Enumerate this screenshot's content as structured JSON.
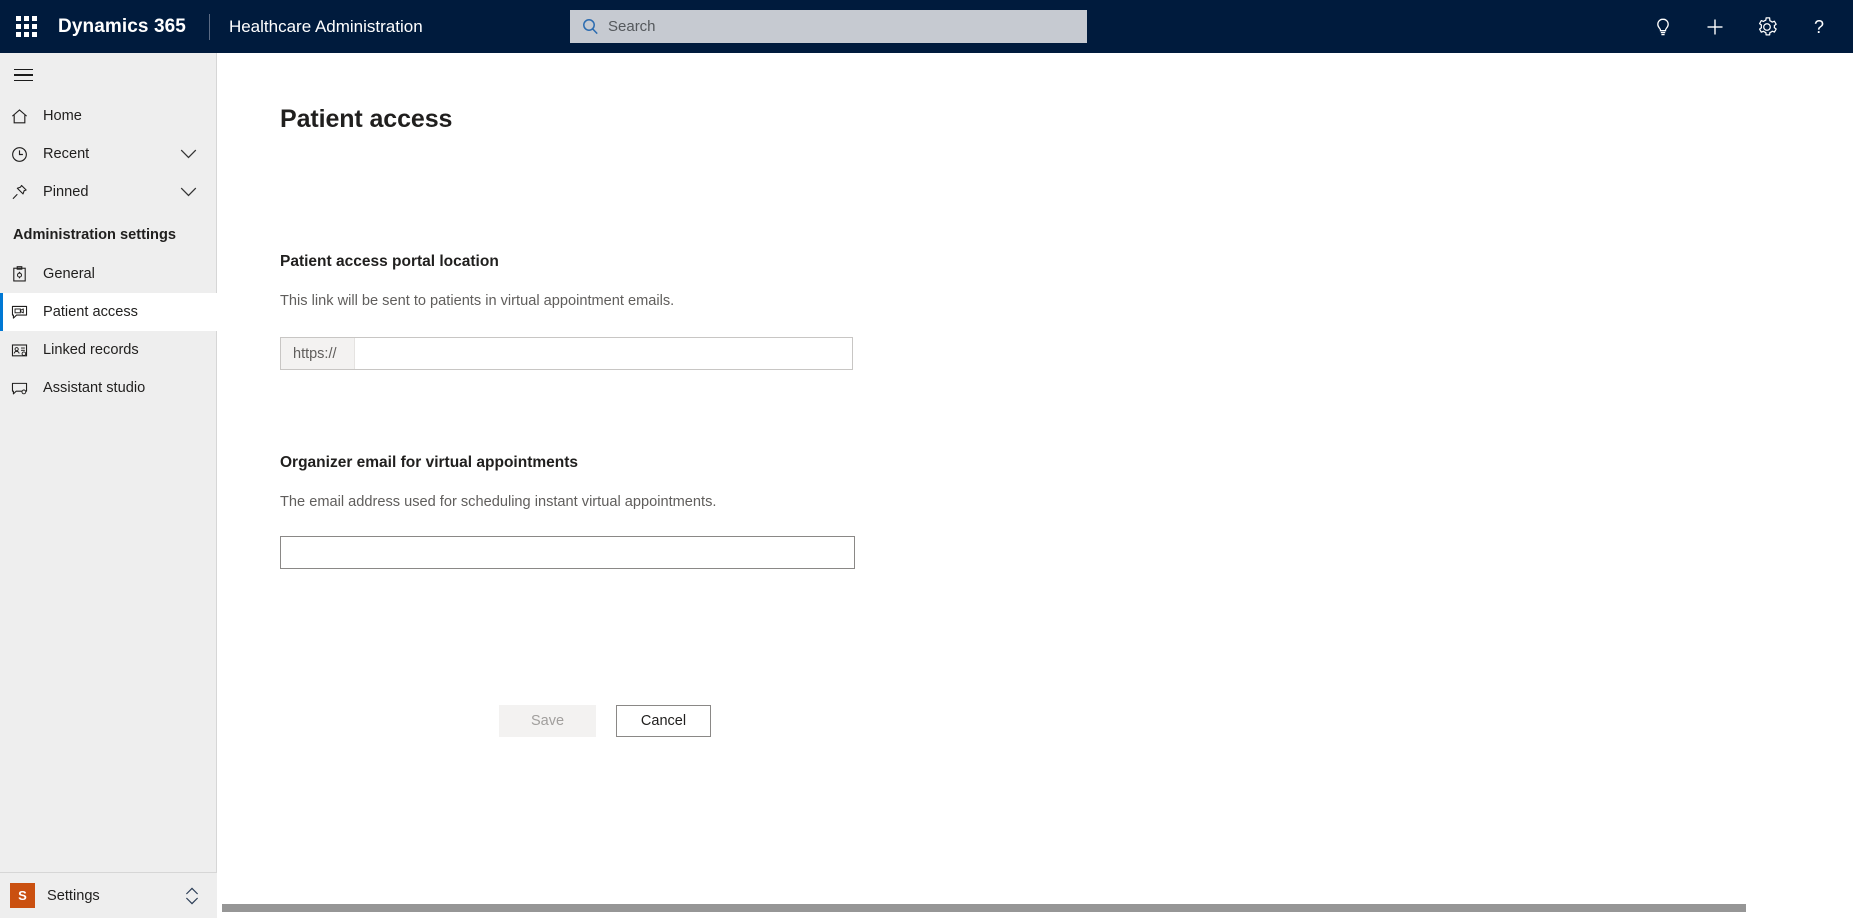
{
  "header": {
    "app_launcher_icon": "waffle-grid-icon",
    "brand": "Dynamics 365",
    "app_name": "Healthcare Administration",
    "search": {
      "placeholder": "Search",
      "value": "",
      "icon": "search-icon"
    },
    "actions": [
      {
        "name": "lightbulb-icon",
        "label": "Lightbulb"
      },
      {
        "name": "plus-icon",
        "label": "New"
      },
      {
        "name": "gear-icon",
        "label": "Settings"
      },
      {
        "name": "question-icon",
        "label": "Help"
      }
    ]
  },
  "sidebar": {
    "collapse_icon": "hamburger-icon",
    "items": [
      {
        "label": "Home",
        "icon": "home-icon",
        "chevron": false,
        "selected": false
      },
      {
        "label": "Recent",
        "icon": "clock-icon",
        "chevron": true,
        "selected": false
      },
      {
        "label": "Pinned",
        "icon": "pin-icon",
        "chevron": true,
        "selected": false
      }
    ],
    "section_title": "Administration settings",
    "section_items": [
      {
        "label": "General",
        "icon": "clipboard-gear-icon",
        "selected": false
      },
      {
        "label": "Patient access",
        "icon": "video-message-icon",
        "selected": true
      },
      {
        "label": "Linked records",
        "icon": "contact-card-gear-icon",
        "selected": false
      },
      {
        "label": "Assistant studio",
        "icon": "chat-gear-icon",
        "selected": false
      }
    ],
    "footer": {
      "badge": "S",
      "label": "Settings",
      "chevron_icon": "chevron-updown-icon"
    }
  },
  "main": {
    "page_title": "Patient access",
    "sections": [
      {
        "heading": "Patient access portal location",
        "description": "This link will be sent to patients in virtual appointment emails.",
        "field": {
          "prefix": "https://",
          "value": "",
          "placeholder": ""
        }
      },
      {
        "heading": "Organizer email for virtual appointments",
        "description": "The email address used for scheduling instant virtual appointments.",
        "field": {
          "value": "",
          "placeholder": ""
        }
      }
    ],
    "actions": {
      "save_label": "Save",
      "save_disabled": true,
      "cancel_label": "Cancel"
    }
  },
  "colors": {
    "header_bg": "#001b3d",
    "sidebar_bg": "#eeeeee",
    "accent": "#0078d4",
    "env_badge": "#ca5010",
    "text_primary": "#201f1e",
    "text_secondary": "#605e5c",
    "search_bg": "#c6cad1",
    "scrollbar": "#969696"
  }
}
